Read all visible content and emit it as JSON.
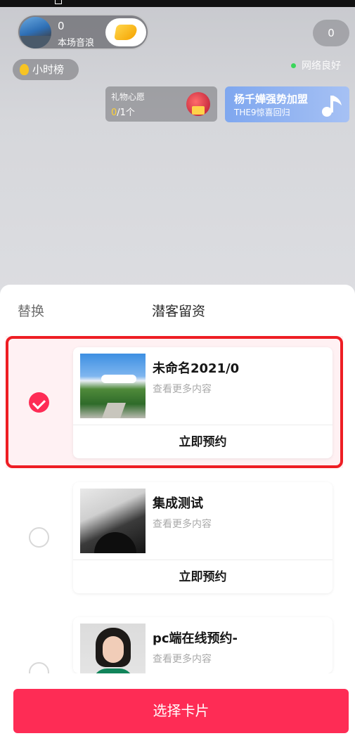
{
  "live": {
    "anchor": {
      "count": "0",
      "label": "本场音浪"
    },
    "viewer_count": "0",
    "rank_label": "小时榜",
    "network_status": "网络良好",
    "wish": {
      "title": "礼物心愿",
      "done": "0",
      "total": "/1个"
    },
    "promo": {
      "title": "杨千嬅强势加盟",
      "subtitle": "THE9惊喜回归"
    }
  },
  "sheet": {
    "left_action": "替换",
    "title": "潜客留资",
    "cards": [
      {
        "title": "未命名2021/0",
        "subtitle": "查看更多内容",
        "action": "立即预约",
        "selected": true,
        "image": "trees-road-sky"
      },
      {
        "title": "集成测试",
        "subtitle": "查看更多内容",
        "action": "立即预约",
        "selected": false,
        "image": "bw-neck-collar"
      },
      {
        "title": "pc端在线预约-",
        "subtitle": "查看更多内容",
        "selected": false,
        "image": "woman-portrait"
      }
    ],
    "select_button": "选择卡片"
  },
  "colors": {
    "accent": "#fe2c55",
    "highlight_border": "#ee1e24",
    "promo_blue": "#7fa7ef"
  }
}
